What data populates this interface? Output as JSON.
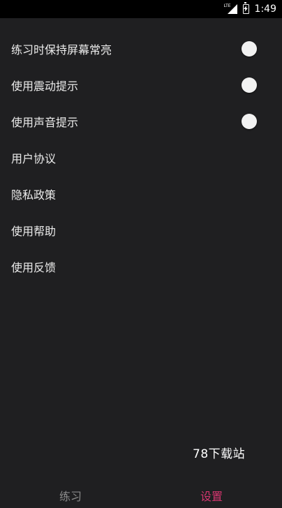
{
  "status_bar": {
    "network": "LTE",
    "time": "1:49"
  },
  "settings": {
    "items": [
      {
        "label": "练习时保持屏幕常亮",
        "has_toggle": true
      },
      {
        "label": "使用震动提示",
        "has_toggle": true
      },
      {
        "label": "使用声音提示",
        "has_toggle": true
      },
      {
        "label": "用户协议",
        "has_toggle": false
      },
      {
        "label": "隐私政策",
        "has_toggle": false
      },
      {
        "label": "使用帮助",
        "has_toggle": false
      },
      {
        "label": "使用反馈",
        "has_toggle": false
      }
    ]
  },
  "watermark": "78下载站",
  "tabs": [
    {
      "label": "练习",
      "active": false
    },
    {
      "label": "设置",
      "active": true
    }
  ],
  "colors": {
    "background": "#1f1f21",
    "accent": "#d4366f",
    "inactive_tab": "#8a8a8a"
  }
}
